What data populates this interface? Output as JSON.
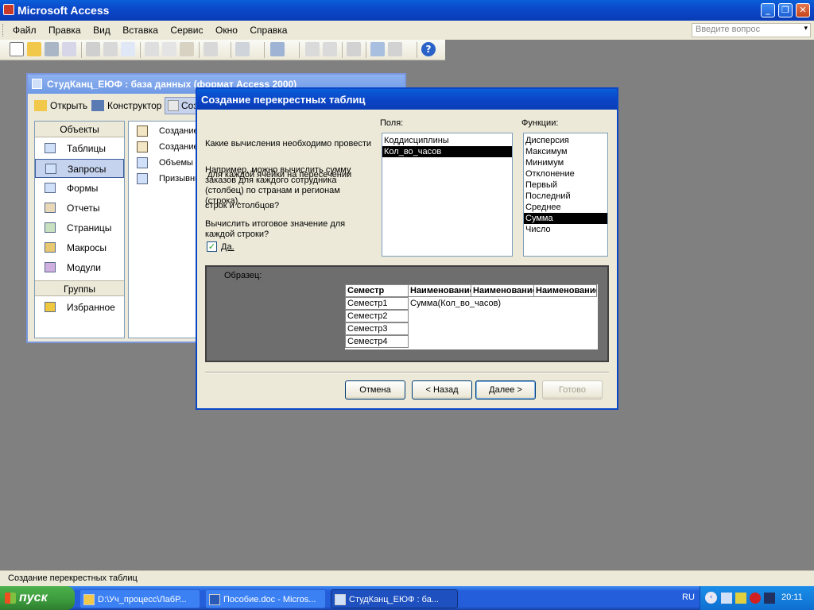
{
  "app": {
    "title": "Microsoft Access"
  },
  "menu": [
    "Файл",
    "Правка",
    "Вид",
    "Вставка",
    "Сервис",
    "Окно",
    "Справка"
  ],
  "ask_question": {
    "placeholder": "Введите вопрос"
  },
  "db_window": {
    "title": "СтудКанц_ЕЮФ : база данных (формат Access 2000)",
    "toolbar": {
      "open": "Открыть",
      "designer": "Конструктор",
      "create": "Создать"
    },
    "objects_header": "Объекты",
    "objects": [
      "Таблицы",
      "Запросы",
      "Формы",
      "Отчеты",
      "Страницы",
      "Макросы",
      "Модули"
    ],
    "groups_header": "Группы",
    "groups": [
      "Избранное"
    ],
    "items": [
      "Создание запроса в режиме конструктора",
      "Создание запроса с помощью мастера",
      "Объемы часов",
      "Призывники"
    ]
  },
  "wizard": {
    "title": "Создание перекрестных таблиц",
    "question": [
      "Какие вычисления необходимо провести",
      " для каждой ячейки на пересечении",
      "строк и столбцов?"
    ],
    "example": [
      "Например, можно вычислить сумму",
      "заказов для каждого сотрудника",
      "(столбец) по странам и регионам",
      "(строка)."
    ],
    "total_question": [
      "Вычислить итоговое значение для",
      "каждой строки?"
    ],
    "checkbox_label": "Да.",
    "checkbox_checked": true,
    "fields_label": "Поля:",
    "fields": [
      "Коддисциплины",
      "Кол_во_часов"
    ],
    "fields_selected": "Кол_во_часов",
    "functions_label": "Функции:",
    "functions": [
      "Дисперсия",
      "Максимум",
      "Минимум",
      "Отклонение",
      "Первый",
      "Последний",
      "Среднее",
      "Сумма",
      "Число"
    ],
    "functions_selected": "Сумма",
    "sample_label": "Образец:",
    "sample": {
      "headers": [
        "Семестр",
        "Наименование",
        "Наименование",
        "Наименование"
      ],
      "rows": [
        "Семестр1",
        "Семестр2",
        "Семестр3",
        "Семестр4"
      ],
      "formula": "Сумма(Кол_во_часов)"
    },
    "buttons": {
      "cancel": "Отмена",
      "back": "< Назад",
      "next": "Далее >",
      "finish": "Готово"
    }
  },
  "status_bar": {
    "text": "Создание перекрестных таблиц"
  },
  "taskbar": {
    "start": "пуск",
    "items": [
      "D:\\Уч_процесс\\ЛабР...",
      "Пособие.doc - Micros...",
      "СтудКанц_ЕЮФ : ба..."
    ],
    "lang": "RU",
    "clock": "20:11"
  },
  "colors": {
    "xp_blue": "#0a46c8",
    "start_green": "#3c9a3c",
    "dialog_bg": "#ece9d8",
    "selection": "#000000"
  }
}
